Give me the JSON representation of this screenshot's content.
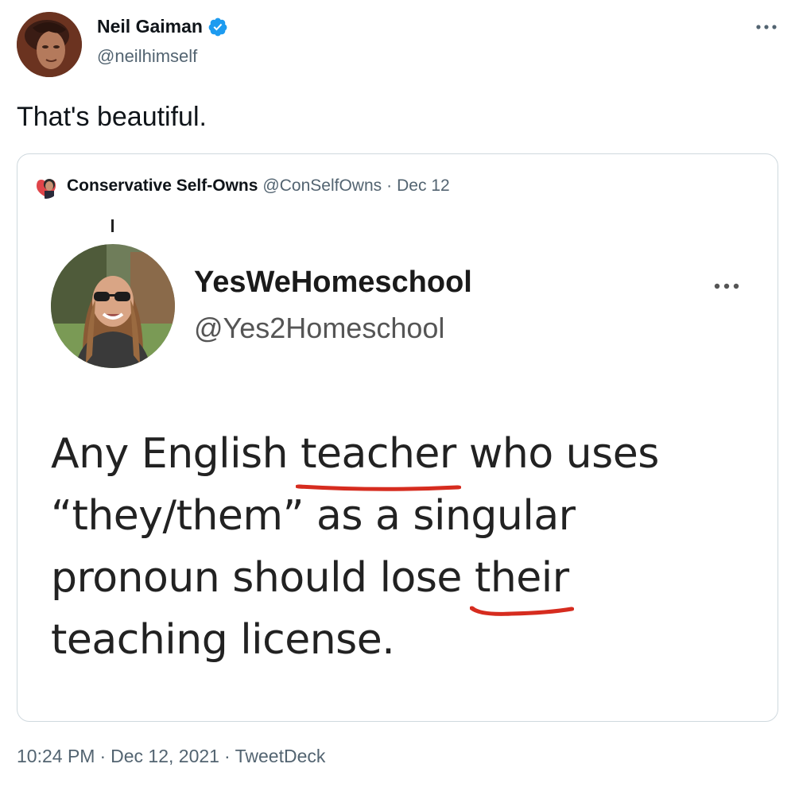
{
  "author": {
    "display_name": "Neil Gaiman",
    "handle": "@neilhimself",
    "verified": true,
    "avatar_icon": "portrait-avatar",
    "verified_icon": "verified-badge-icon",
    "verified_color": "#1d9bf0"
  },
  "tweet": {
    "text": "That's beautiful."
  },
  "quoted_tweet": {
    "display_name": "Conservative Self-Owns",
    "handle": "@ConSelfOwns",
    "separator": "·",
    "date": "Dec 12",
    "screenshot": {
      "display_name": "YesWeHomeschool",
      "handle": "@Yes2Homeschool",
      "body_lines": [
        "Any English ",
        "teacher",
        " who uses",
        "“they/them” as a singular",
        "pronoun should lose ",
        "their",
        "teaching license."
      ],
      "underline_color": "#d62c1f"
    }
  },
  "meta": {
    "time": "10:24 PM",
    "separator": "·",
    "date": "Dec 12, 2021",
    "source": "TweetDeck"
  },
  "colors": {
    "text": "#0f1419",
    "secondary": "#536471",
    "border": "#cfd9de",
    "link_blue": "#1d9bf0"
  }
}
